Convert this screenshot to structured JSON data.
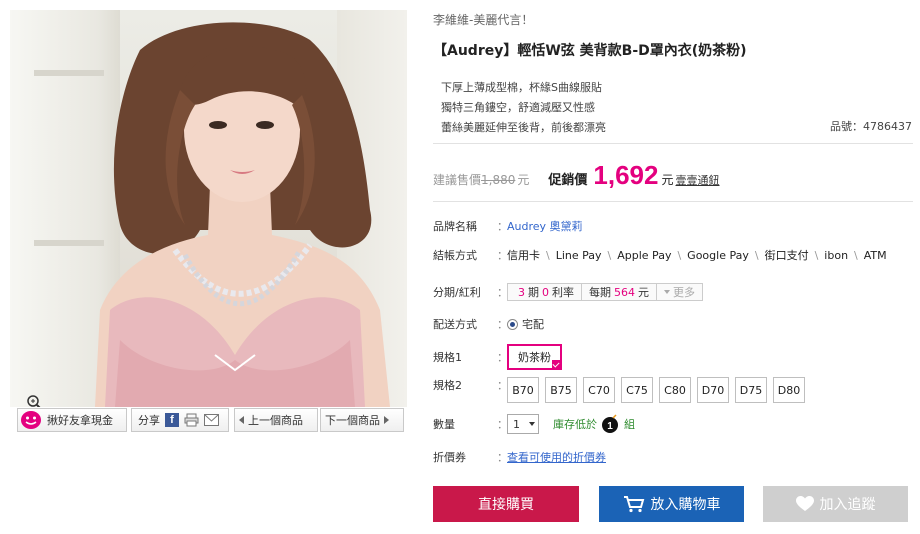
{
  "gallery": {
    "share_friend_label": "揪好友拿現金",
    "share_label": "分享",
    "facebook_glyph": "f",
    "prev_label": "上一個商品",
    "next_label": "下一個商品",
    "icons": [
      "zoom-icon",
      "smile-face-icon",
      "facebook-icon",
      "print-icon",
      "mail-icon"
    ]
  },
  "product": {
    "slogan": "李維維-美麗代言！",
    "title": "【Audrey】輕恬W弦 美背款B-D罩內衣(奶茶粉)",
    "features": [
      "下厚上薄成型棉，杯緣S曲線服貼",
      "獨特三角鏤空，舒適減壓又性感",
      "蕾絲美麗延伸至後背，前後都漂亮"
    ],
    "product_no_label": "品號：",
    "product_no": "4786437"
  },
  "price": {
    "list_label": "建議售價",
    "list_price": "1,880",
    "list_unit": "元",
    "promo_label": "促銷價",
    "promo_price": "1,692",
    "promo_unit": "元",
    "sign_link": "壹壹通鈕",
    "accent_color": "#e4007f"
  },
  "details": {
    "brand_label": "品牌名稱",
    "brand_value": "Audrey 奧黛莉",
    "payment_label": "結帳方式",
    "payments": [
      "信用卡",
      "Line Pay",
      "Apple Pay",
      "Google Pay",
      "街口支付",
      "ibon",
      "ATM"
    ],
    "installment_label": "分期/紅利",
    "installment": {
      "periods": "3",
      "periods_unit": "期",
      "rate": "0",
      "rate_unit": "利率",
      "monthly_label": "每期",
      "monthly": "564",
      "monthly_unit": "元",
      "more_label": "更多"
    },
    "delivery_label": "配送方式",
    "delivery_value": "宅配",
    "spec1_label": "規格1",
    "spec1_selected": "奶茶粉",
    "spec2_label": "規格2",
    "spec2_options": [
      "B70",
      "B75",
      "C70",
      "C75",
      "C80",
      "D70",
      "D75",
      "D80"
    ],
    "qty_label": "數量",
    "qty_value": "1",
    "stock_prefix": "庫存低於",
    "stock_count": "1",
    "stock_suffix": "組",
    "coupon_label": "折價券",
    "coupon_link": "查看可使用的折價券",
    "colon": "："
  },
  "actions": {
    "buy_now": "直接購買",
    "add_cart": "放入購物車",
    "add_track": "加入追蹤",
    "buy_color": "#c9184a",
    "cart_color": "#1b63b6",
    "track_color": "#cfcfcf"
  }
}
